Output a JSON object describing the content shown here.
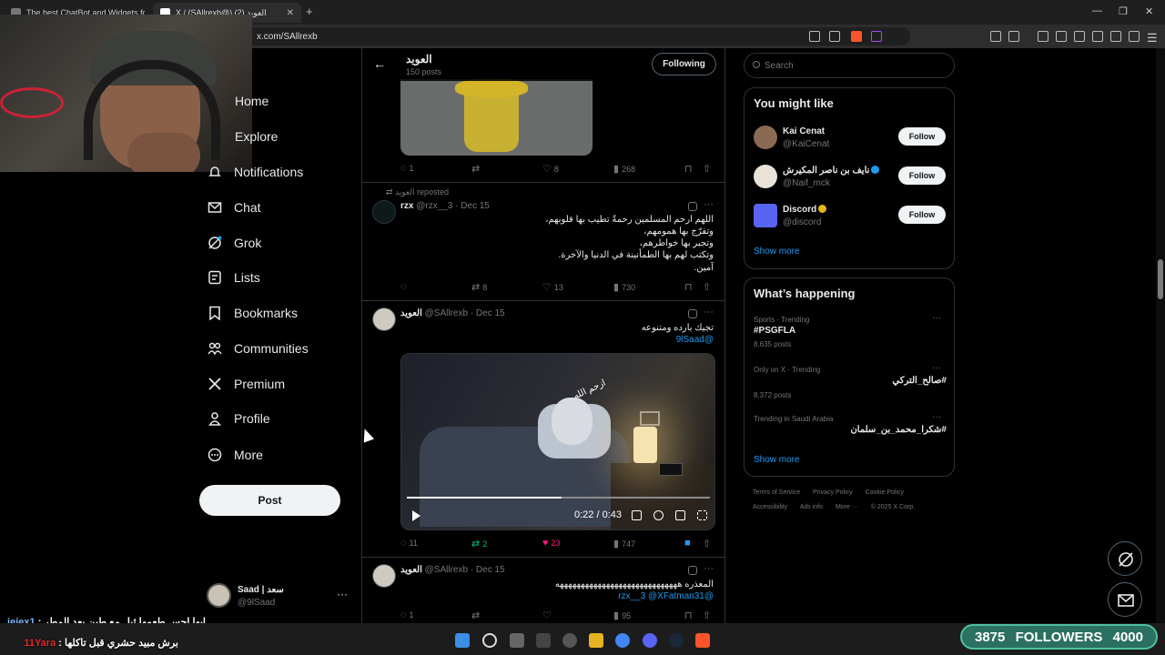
{
  "browser": {
    "tabs": [
      {
        "title": "The best ChatBot and Widgets for K..."
      },
      {
        "title": "X / (SAllrexb@) العويد (2)"
      }
    ],
    "url": "x.com/SAllrexb"
  },
  "nav": {
    "items": [
      {
        "label": "Home"
      },
      {
        "label": "Explore"
      },
      {
        "label": "Notifications"
      },
      {
        "label": "Chat"
      },
      {
        "label": "Grok"
      },
      {
        "label": "Lists"
      },
      {
        "label": "Bookmarks"
      },
      {
        "label": "Communities"
      },
      {
        "label": "Premium"
      },
      {
        "label": "Profile"
      },
      {
        "label": "More"
      }
    ],
    "post_label": "Post",
    "account": {
      "name": "Saad | سعد",
      "handle": "@9lSaad"
    }
  },
  "profile_header": {
    "name": "العويد",
    "posts": "150 posts",
    "follow_label": "Following"
  },
  "tweets": [
    {
      "actions": {
        "replies": "1",
        "reposts": "",
        "likes": "8",
        "views": "268"
      }
    },
    {
      "repost_line": "العويد reposted",
      "name": "rzx",
      "meta": "@rzx__3 · Dec 15",
      "lines": [
        "اللهم ارحم المسلمين رحمةً تطيب بها قلوبهم،",
        "وتفرّج بها همومهم،",
        "وتجبر بها خواطرهم،",
        "وتكتب لهم بها الطمأنينة في الدنيا والآخرة.",
        "آمين."
      ],
      "actions": {
        "replies": "",
        "reposts": "8",
        "likes": "13",
        "views": "730"
      }
    },
    {
      "name": "العويد",
      "meta": "@SAllrexb · Dec 15",
      "text": "تجيك بارده ومتنوعه",
      "mention": "@9lSaad",
      "video": {
        "time": "0:22 / 0:43",
        "overlay_text": "ازحم الله",
        "progress": 0.51
      },
      "actions": {
        "replies": "11",
        "reposts": "2",
        "likes": "23",
        "views": "747"
      }
    },
    {
      "name": "العويد",
      "meta": "@SAllrexb · Dec 15",
      "text": "المعذره هههههههههههههههههههههههههههههه",
      "mention": "@rzx__3 @XFatman31",
      "actions": {
        "replies": "1",
        "reposts": "",
        "likes": "",
        "views": "95"
      }
    }
  ],
  "sidebar": {
    "search_placeholder": "Search",
    "you_might_like": {
      "title": "You might like",
      "users": [
        {
          "name": "Kai Cenat",
          "handle": "@KaiCenat",
          "button": "Follow"
        },
        {
          "name": "نايف بن ناصر المكيرش",
          "handle": "@Naif_mck",
          "button": "Follow"
        },
        {
          "name": "Discord",
          "handle": "@discord",
          "button": "Follow"
        }
      ],
      "show_more": "Show more"
    },
    "whats_happening": {
      "title": "What’s happening",
      "trends": [
        {
          "context": "Sports · Trending",
          "topic": "#PSGFLA",
          "count": "8,635 posts"
        },
        {
          "context": "Only on X · Trending",
          "topic": "#صالح_التركي",
          "count": "8,372 posts"
        },
        {
          "context": "Trending in Saudi Arabia",
          "topic": "#شكرا_محمد_بن_سلمان",
          "count": ""
        }
      ],
      "show_more": "Show more"
    },
    "footer": [
      "Terms of Service",
      "Privacy Policy",
      "Cookie Policy",
      "Accessibility",
      "Ads info",
      "More ···",
      "© 2025 X Corp."
    ]
  },
  "chat_overlay": [
    {
      "user": "jejex1",
      "message": "ابها احس طعمها ثيل مع طين بعد المطر"
    },
    {
      "user": "11Yara",
      "message": "برش مبيد حشري قبل تاكلها"
    }
  ],
  "stream": {
    "followers_current": "3875",
    "followers_label": "FOLLOWERS",
    "followers_goal": "4000"
  },
  "colors": {
    "background": "#000000",
    "accent": "#1d9bf0",
    "like": "#f91880",
    "repost": "#00ba7c",
    "followers_bar": "#2b7060"
  }
}
